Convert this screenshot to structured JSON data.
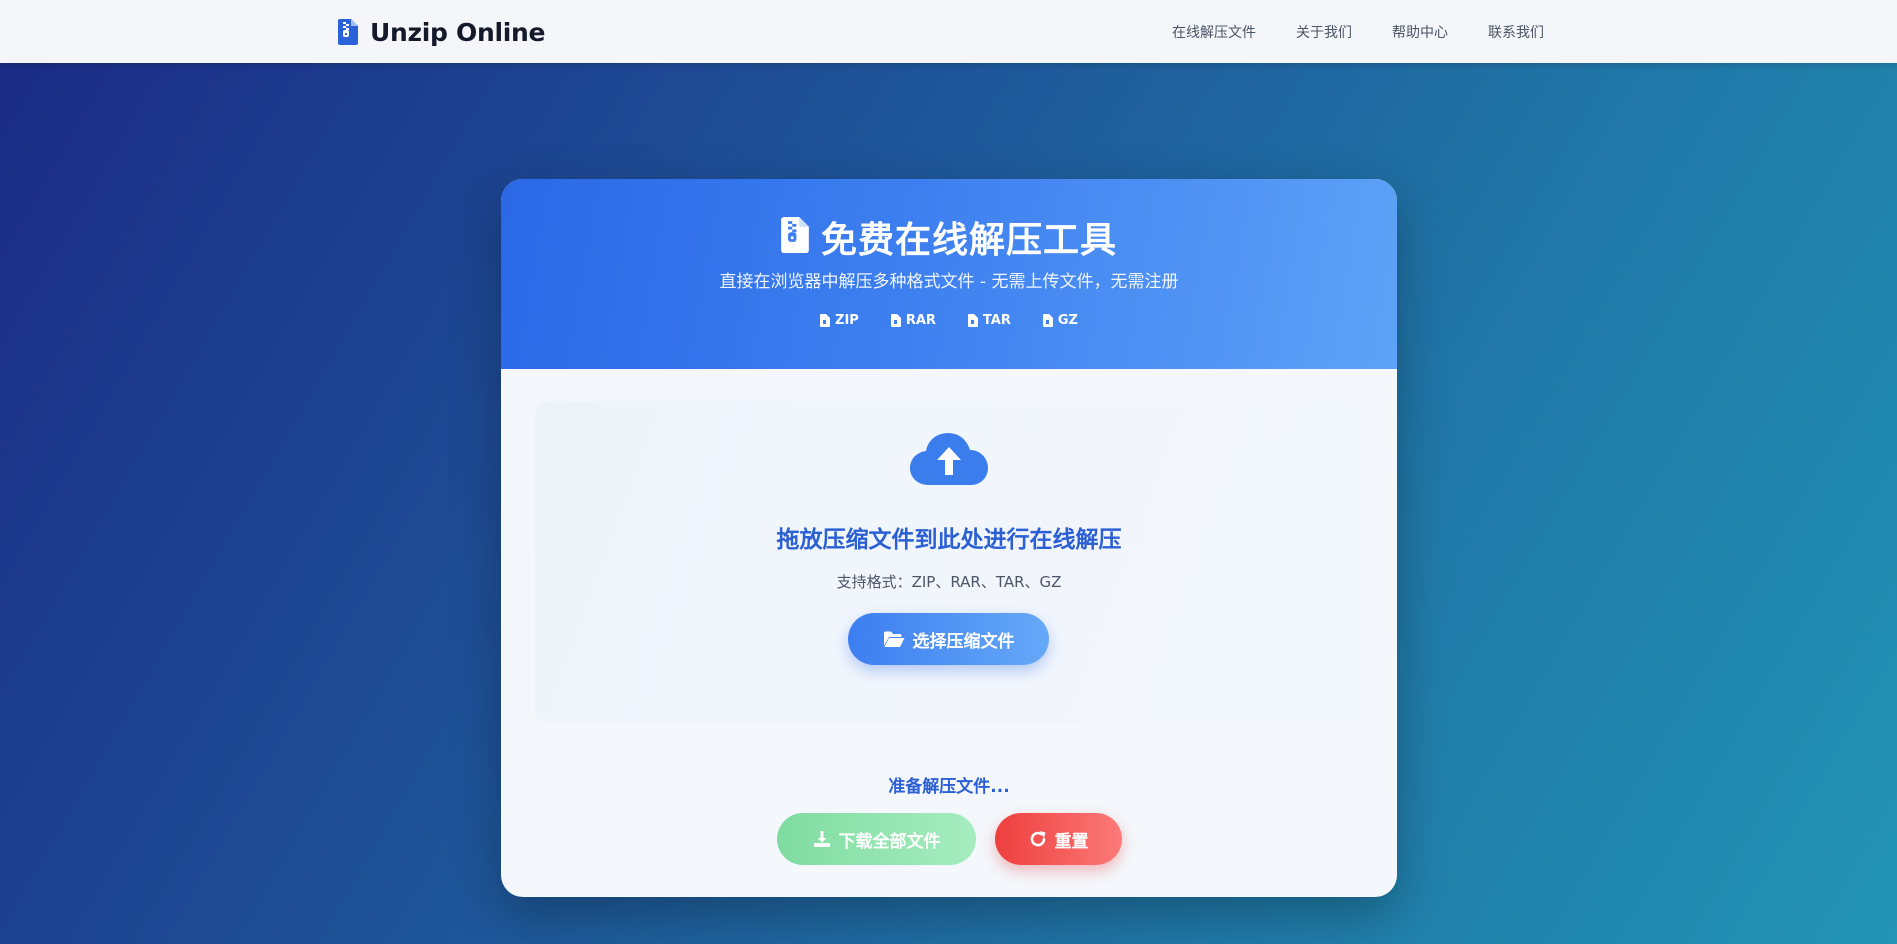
{
  "navbar": {
    "brand_name": "Unzip Online",
    "brand_icon": "zip-file-icon",
    "links": [
      {
        "label": "在线解压文件"
      },
      {
        "label": "关于我们"
      },
      {
        "label": "帮助中心"
      },
      {
        "label": "联系我们"
      }
    ]
  },
  "hero": {
    "icon": "zip-file-icon",
    "title": "免费在线解压工具",
    "subtitle": "直接在浏览器中解压多种格式文件 - 无需上传文件，无需注册",
    "formats": [
      {
        "label": "ZIP",
        "icon": "file-icon"
      },
      {
        "label": "RAR",
        "icon": "file-icon"
      },
      {
        "label": "TAR",
        "icon": "file-icon"
      },
      {
        "label": "GZ",
        "icon": "file-icon"
      }
    ]
  },
  "drop_zone": {
    "icon": "cloud-upload-icon",
    "title": "拖放压缩文件到此处进行在线解压",
    "supported_formats": "支持格式：ZIP、RAR、TAR、GZ",
    "select_button_label": "选择压缩文件",
    "select_button_icon": "folder-open-icon"
  },
  "status": {
    "text": "准备解压文件..."
  },
  "actions": {
    "download_label": "下载全部文件",
    "download_icon": "download-icon",
    "reset_label": "重置",
    "reset_icon": "redo-icon"
  },
  "colors": {
    "accent": "#2b5fd4",
    "header_gradient_start": "#2b68e6",
    "header_gradient_end": "#5ea2f7",
    "download_green": "#7fdca0",
    "reset_red": "#ee3e3e"
  }
}
